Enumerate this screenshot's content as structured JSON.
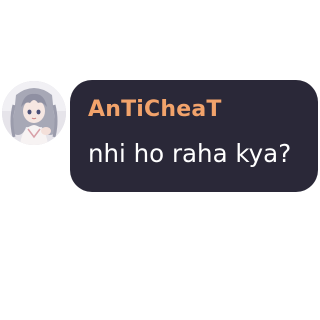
{
  "message": {
    "author": {
      "name": "AnTiCheaT",
      "name_color": "#f2a36b",
      "avatar": "anime-girl-avatar"
    },
    "text": "nhi ho raha kya?",
    "bubble_color": "#2a2838",
    "text_color": "#ffffff"
  }
}
